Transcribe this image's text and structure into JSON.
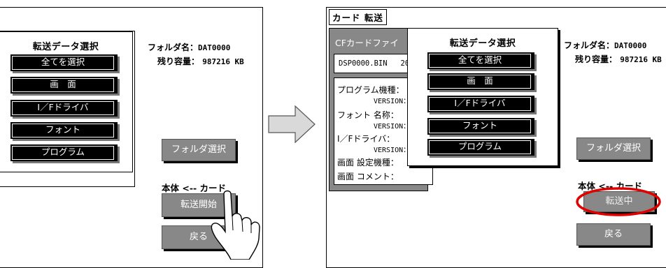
{
  "left_screen": {
    "dialog_title": "転送データ選択",
    "buttons": [
      "全てを選択",
      "画　面",
      "I／Fドライバ",
      "フォント",
      "プログラム"
    ],
    "folder_label": "フォルダ名：",
    "folder_value": "DAT0000",
    "remaining_label": "残り容量：",
    "remaining_value": "987216 KB",
    "folder_select_button": "フォルダ選択",
    "direction_label": "本体 <-- カード",
    "transfer_start_button": "転送開始",
    "back_button": "戻る"
  },
  "right_screen": {
    "tab_title": "カード 転送",
    "cf_panel_title": "CFカードファイ",
    "cf_file_name": "DSP0000.BIN",
    "cf_file_extra": "20",
    "info_rows": [
      {
        "label": "プログラム機種：",
        "sub": "VERSION："
      },
      {
        "label": "フォント 名称：",
        "sub": "VERSION："
      },
      {
        "label": "I／Fドライバ：",
        "sub": "VERSION："
      },
      {
        "label": "画面 設定機種：",
        "sub": ""
      },
      {
        "label": "画面 コメント：",
        "sub": ""
      }
    ],
    "dialog_title": "転送データ選択",
    "buttons": [
      "全てを選択",
      "画　面",
      "I／Fドライバ",
      "フォント",
      "プログラム"
    ],
    "folder_label": "フォルダ名：",
    "folder_value": "DAT0000",
    "remaining_label": "残り容量：",
    "remaining_value": "987216 KB",
    "folder_select_button": "フォルダ選択",
    "direction_label": "本体 <-- カード",
    "transferring_button": "転送中",
    "back_button": "戻る"
  },
  "colors": {
    "button_gray": "#888888",
    "highlight_circle": "#e00000",
    "arrow_fill": "#d9d9d9"
  }
}
